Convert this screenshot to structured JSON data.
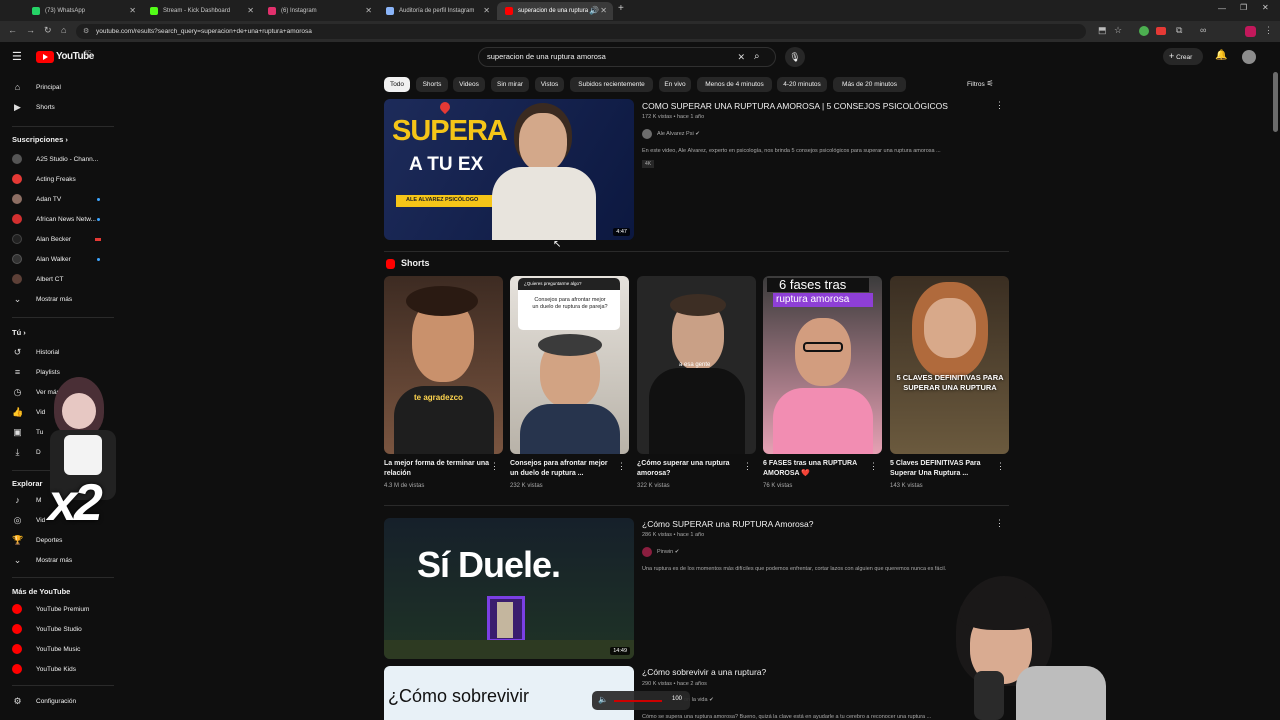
{
  "browser": {
    "tabs": [
      {
        "label": "(73) WhatsApp",
        "color": "#25d366"
      },
      {
        "label": "Stream - Kick Dashboard",
        "color": "#53fc18"
      },
      {
        "label": "(6) Instagram",
        "color": "#e1306c"
      },
      {
        "label": "Auditoría de perfil Instagram",
        "color": "#8ab4f8"
      },
      {
        "label": "superacion de una ruptura",
        "color": "#ff0000"
      }
    ],
    "url": "youtube.com/results?search_query=superacion+de+una+ruptura+amorosa"
  },
  "header": {
    "logo": "YouTube",
    "country": "EC",
    "search_value": "superacion de una ruptura amorosa",
    "create_label": "Crear"
  },
  "sidebar": {
    "main": [
      {
        "label": "Principal",
        "icon": "home-icon"
      },
      {
        "label": "Shorts",
        "icon": "shorts-icon"
      }
    ],
    "subs_title": "Suscripciones",
    "subs": [
      {
        "label": "A25 Studio - Chann...",
        "color": "#444",
        "dot": false
      },
      {
        "label": "Acting Freaks",
        "color": "#e53935",
        "dot": false
      },
      {
        "label": "Adan TV",
        "color": "#8d6e63",
        "dot": true
      },
      {
        "label": "African News Netw...",
        "color": "#d32f2f",
        "dot": true
      },
      {
        "label": "Alan Becker",
        "color": "#111",
        "dot": false
      },
      {
        "label": "Alan Walker",
        "color": "#333",
        "dot": true
      },
      {
        "label": "Albert CT",
        "color": "#5d4037",
        "dot": false
      }
    ],
    "show_more": "Mostrar más",
    "you_title": "Tú",
    "you": [
      {
        "label": "Historial",
        "icon": "history-icon"
      },
      {
        "label": "Playlists",
        "icon": "playlist-icon"
      },
      {
        "label": "Ver más",
        "icon": "clock-icon"
      },
      {
        "label": "Vid",
        "icon": "like-icon"
      },
      {
        "label": "Tu",
        "icon": "video-icon"
      },
      {
        "label": "D",
        "icon": "download-icon"
      }
    ],
    "explore_title": "Explorar",
    "explore": [
      {
        "label": "M",
        "icon": "music-icon"
      },
      {
        "label": "Vid",
        "icon": "gaming-icon"
      },
      {
        "label": "Deportes",
        "icon": "trophy-icon"
      }
    ],
    "show_more2": "Mostrar más",
    "more_title": "Más de YouTube",
    "more": [
      {
        "label": "YouTube Premium"
      },
      {
        "label": "YouTube Studio"
      },
      {
        "label": "YouTube Music"
      },
      {
        "label": "YouTube Kids"
      }
    ],
    "settings": "Configuración"
  },
  "chips": [
    "Todo",
    "Shorts",
    "Videos",
    "Sin mirar",
    "Vistos",
    "Subidos recientemente",
    "En vivo",
    "Menos de 4 minutos",
    "4-20 minutos",
    "Más de 20 minutos"
  ],
  "filters_label": "Filtros",
  "video1": {
    "title": "COMO SUPERAR UNA RUPTURA AMOROSA | 5 CONSEJOS PSICOLÓGICOS",
    "meta": "172 K vistas • hace 1 año",
    "channel": "Ale Alvarez Psi",
    "desc": "En este video, Ale Álvarez, experto en psicología, nos brinda 5 consejos psicológicos para superar una ruptura amorosa ...",
    "badge": "4K",
    "duration": "4:47",
    "thumb_big": "SUPERA",
    "thumb_small": "A TU EX",
    "thumb_tag": "ALE ALVAREZ PSICÓLOGO"
  },
  "shorts_title": "Shorts",
  "shorts": [
    {
      "title": "La mejor forma de terminar una relación",
      "views": "4.3 M de vistas",
      "caption": "te agradezco",
      "bg": "#6b4a35"
    },
    {
      "title": "Consejos para afrontar mejor un duelo de ruptura ...",
      "views": "232 K vistas",
      "caption": "",
      "bg": "#c9c4bd",
      "card_q": "¿Quieres preguntarme algo?",
      "card_a": "Consejos para afrontar mejor un duelo de ruptura de pareja?"
    },
    {
      "title": "¿Cómo superar una ruptura amorosa?",
      "views": "322 K vistas",
      "caption": "a esa gente",
      "bg": "#2a2a2a"
    },
    {
      "title": "6 FASES tras una RUPTURA AMOROSA ❤️",
      "views": "76 K vistas",
      "caption": "",
      "bg": "#d9a7b3",
      "top1": "6 fases tras",
      "top2": "ruptura amorosa"
    },
    {
      "title": "5 Claves DEFINITIVAS Para Superar Una Ruptura ...",
      "views": "143 K vistas",
      "caption": "5 CLAVES DEFINITIVAS PARA SUPERAR UNA RUPTURA",
      "bg": "#4a3a2a"
    }
  ],
  "video2": {
    "title": "¿Cómo SUPERAR una RUPTURA Amorosa?",
    "meta": "286 K vistas • hace 1 año",
    "channel": "Pinwin",
    "desc": "Una ruptura es de los momentos más difíciles que podemos enfrentar, cortar lazos con alguien que queremos nunca es fácil.",
    "duration": "14:49",
    "thumb_text": "Sí Duele."
  },
  "video3": {
    "title": "¿Cómo sobrevivir a una ruptura?",
    "meta": "290 K vistas • hace 2 años",
    "thumb_text": "¿Cómo sobrevivir",
    "channel_fragment": "on la vida",
    "desc": "Cómo se supera una ruptura amorosa? Bueno, quizá la clave está en ayudarle a tu cerebro a reconocer una ruptura ..."
  },
  "volume": {
    "value": "100"
  },
  "overlay_text": "x2"
}
